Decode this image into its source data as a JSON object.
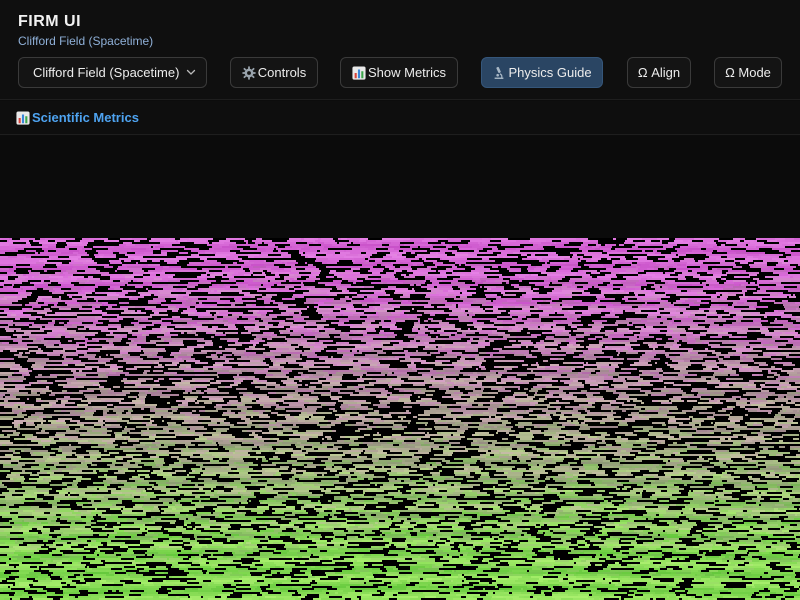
{
  "header": {
    "title": "FIRM UI",
    "subtitle": "Clifford Field (Spacetime)"
  },
  "toolbar": {
    "field_select": {
      "value": "Clifford Field (Spacetime)",
      "icon": "chevron-down-icon"
    },
    "controls": {
      "label": "Controls",
      "icon": "gear-icon"
    },
    "show_metrics": {
      "label": "Show Metrics",
      "icon": "bar-chart-icon"
    },
    "physics_guide": {
      "label": "Physics Guide",
      "icon": "microscope-icon",
      "active": true
    },
    "align": {
      "label": "Ω Align"
    },
    "mode": {
      "label": "Ω Mode"
    }
  },
  "metrics": {
    "title": "Scientific Metrics",
    "icon": "bar-chart-icon"
  },
  "visualization": {
    "description_colors": [
      "#c050c0",
      "#e070e0",
      "#9a40a0",
      "#60c040",
      "#a0f060",
      "#3a8a2a"
    ]
  }
}
